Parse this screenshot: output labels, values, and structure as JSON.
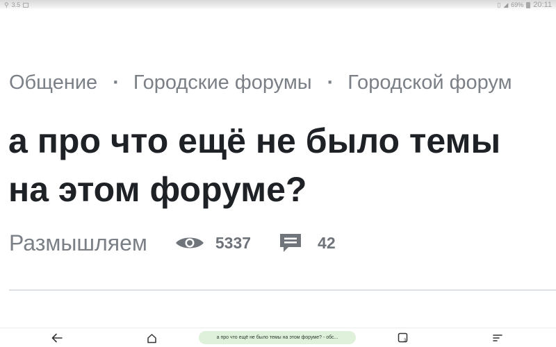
{
  "status_bar": {
    "left_text": "3.5",
    "battery": "69%",
    "time": "20:11"
  },
  "breadcrumb": {
    "items": [
      {
        "label": "Общение"
      },
      {
        "label": "Городские форумы"
      },
      {
        "label": "Городской форум"
      }
    ],
    "separator": "·"
  },
  "topic": {
    "title": "а про что ещё не было темы на этом форуме?",
    "category": "Размышляем",
    "views": "5337",
    "comments": "42"
  },
  "icons": {
    "views": "eye-icon",
    "comments": "comment-icon"
  },
  "nav_bar": {
    "tab_title": "а про что ещё не было темы на этом форуме? - обс...",
    "buttons": [
      "back-arrow-icon",
      "home-icon",
      "tabs-icon",
      "menu-icon"
    ]
  },
  "colors": {
    "title": "#1e2126",
    "muted": "#7b8087",
    "icon": "#70757c",
    "tab_chip": "#dff1db"
  }
}
